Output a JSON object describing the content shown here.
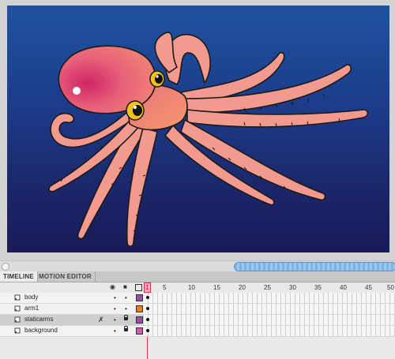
{
  "timeline": {
    "tabs": [
      "TIMELINE",
      "MOTION EDITOR"
    ],
    "ruler": [
      "1",
      "5",
      "10",
      "15",
      "20",
      "25",
      "30",
      "35",
      "40",
      "45",
      "50"
    ],
    "playhead_frame": "1",
    "layers": [
      {
        "name": "body",
        "color": "#9b4fa8",
        "selected": false
      },
      {
        "name": "arm1",
        "color": "#ee7c17",
        "selected": false
      },
      {
        "name": "staticarms",
        "color": "#9b4fa8",
        "selected": true
      },
      {
        "name": "background",
        "color": "#d15bb0",
        "selected": false
      }
    ]
  },
  "colors": {
    "stage_top": "#1e53a1",
    "stage_bottom": "#1a1a58",
    "octopus_body": "#e8607a",
    "octopus_arms": "#f39a8f",
    "playhead": "#d1324a"
  }
}
